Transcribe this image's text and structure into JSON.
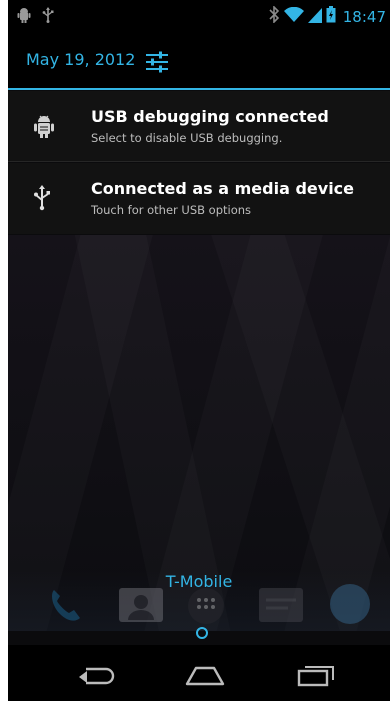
{
  "status_bar": {
    "left_icons": [
      "android-debug-icon",
      "usb-icon"
    ],
    "right_icons": [
      "bluetooth-icon",
      "wifi-icon",
      "signal-icon",
      "battery-icon"
    ],
    "time": "18:47"
  },
  "quick_panel": {
    "date": "May 19, 2012",
    "settings_icon": "settings-sliders-icon"
  },
  "notifications": [
    {
      "icon": "android-debug-icon",
      "title": "USB debugging connected",
      "subtitle": "Select to disable USB debugging."
    },
    {
      "icon": "usb-icon",
      "title": "Connected as a media device",
      "subtitle": "Touch for other USB options"
    }
  ],
  "home": {
    "carrier": "T-Mobile",
    "dock_icons": [
      "phone-icon",
      "contacts-icon",
      "app-drawer-icon",
      "messaging-icon",
      "browser-icon"
    ]
  },
  "nav_bar": {
    "buttons": [
      "back-icon",
      "home-icon",
      "recents-icon"
    ]
  },
  "colors": {
    "accent": "#33b5e5",
    "panel_bg": "#121212",
    "status_bg": "#000000"
  }
}
